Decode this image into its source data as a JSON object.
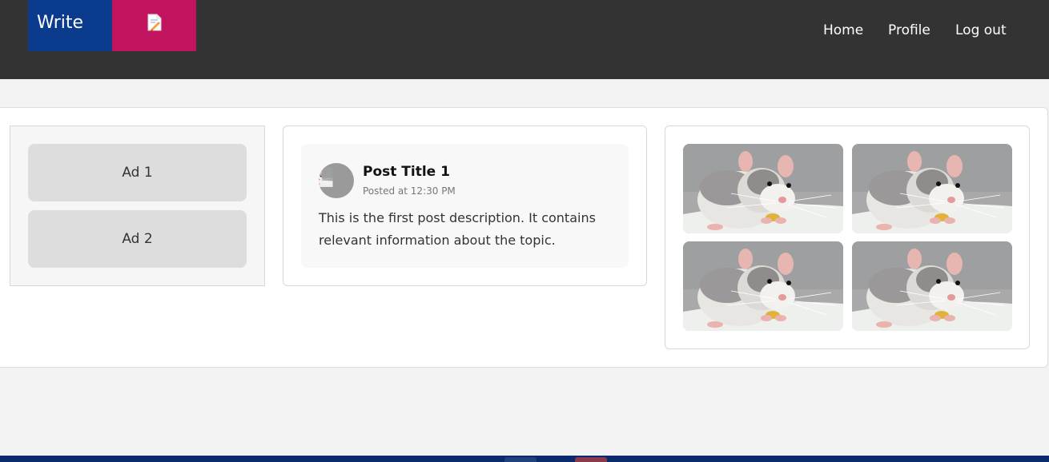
{
  "header": {
    "write_label": "Write",
    "nav": {
      "home": "Home",
      "profile": "Profile",
      "logout": "Log out"
    }
  },
  "ads": {
    "items": [
      {
        "label": "Ad 1"
      },
      {
        "label": "Ad 2"
      }
    ]
  },
  "post": {
    "title": "Post Title 1",
    "time": "Posted at 12:30 PM",
    "description": "This is the first post description. It contains relevant information about the topic."
  },
  "gallery": {
    "image_subject": "rat"
  },
  "colors": {
    "topbar": "#333333",
    "write_blue": "#0b3b8c",
    "write_pink": "#c2135e",
    "page_bg": "#f3f3f3",
    "ad_box": "#dddddd",
    "taskbar": "#0b2a6e"
  }
}
